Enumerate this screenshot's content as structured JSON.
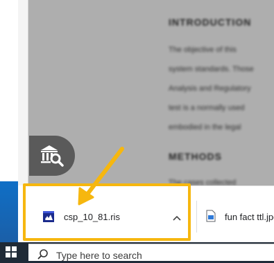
{
  "page": {
    "headings": [
      "INTRODUCTION",
      "METHODS"
    ],
    "body_lines": [
      "The objective of this",
      "system standards. Those",
      "Analysis and Regulatory",
      "test is a normally used",
      "embodied in the legal"
    ],
    "body_lines_after_methods": [
      "The cases collected"
    ]
  },
  "library_button": {
    "icon": "library-search-icon"
  },
  "download_bar": {
    "items": [
      {
        "filename": "csp_10_81.ris",
        "icon": "ris-file-icon",
        "menu_icon": "chevron-up-icon"
      },
      {
        "filename": "fun fact ttl.jpg",
        "icon": "image-file-icon"
      }
    ]
  },
  "annotation": {
    "highlight_color": "#f6b70f"
  },
  "taskbar": {
    "start_icon": "windows-logo-icon",
    "search_placeholder": "Type here to search"
  }
}
